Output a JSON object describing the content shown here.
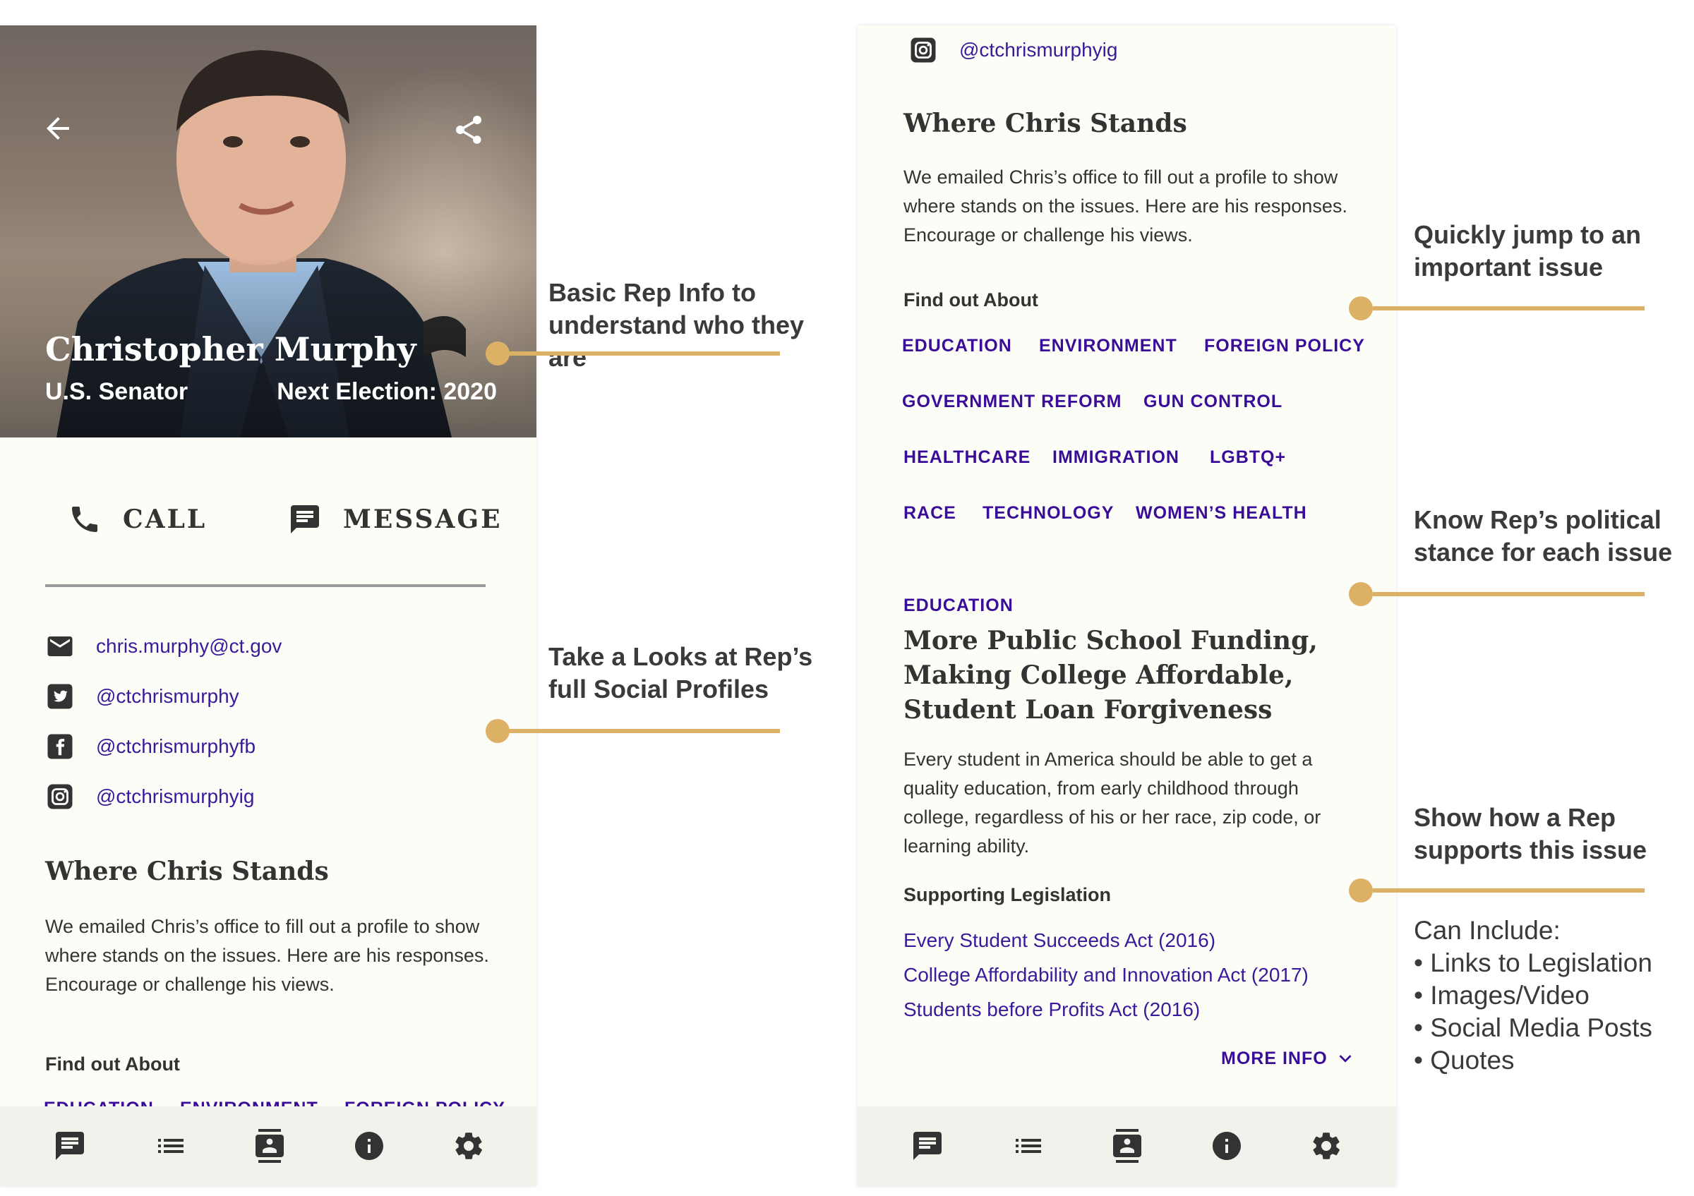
{
  "left_screen": {
    "hero": {
      "name": "Christopher Murphy",
      "role": "U.S. Senator",
      "election": "Next Election: 2020"
    },
    "actions": {
      "call": "CALL",
      "message": "MESSAGE"
    },
    "contacts": {
      "email": "chris.murphy@ct.gov",
      "twitter": "@ctchrismurphy",
      "facebook": "@ctchrismurphyfb",
      "instagram": "@ctchrismurphyig"
    },
    "stands": {
      "title": "Where Chris Stands",
      "body": "We emailed Chris’s office to fill out a profile to show where stands on the issues. Here are his responses. Encourage or challenge his views."
    },
    "find_out": {
      "label": "Find out About",
      "topics": [
        "EDUCATION",
        "ENVIRONMENT",
        "FOREIGN POLICY"
      ]
    }
  },
  "right_screen": {
    "instagram": "@ctchrismurphyig",
    "stands": {
      "title": "Where Chris Stands",
      "body": "We emailed Chris’s office to fill out a profile to show where stands on the issues. Here are his responses. Encourage or challenge his views."
    },
    "find_out": {
      "label": "Find out About",
      "topics": [
        "EDUCATION",
        "ENVIRONMENT",
        "FOREIGN POLICY",
        "GOVERNMENT REFORM",
        "GUN CONTROL",
        "HEALTHCARE",
        "IMMIGRATION",
        "LGBTQ+",
        "RACE",
        "TECHNOLOGY",
        "WOMEN’S HEALTH"
      ]
    },
    "issue": {
      "category": "EDUCATION",
      "title": "More Public School Funding, Making College Affordable, Student Loan Forgiveness",
      "body": "Every student in America should be able to get a quality education, from early childhood through college, regardless of his or her race, zip code, or learning ability.",
      "legislation_label": "Supporting Legislation",
      "legislation": [
        "Every Student Succeeds Act (2016)",
        "College Affordability and Innovation Act (2017)",
        "Students before Profits Act (2016)"
      ],
      "more_info": "MORE INFO"
    }
  },
  "nav_icons": [
    "chat-icon",
    "list-icon",
    "contact-card-icon",
    "info-icon",
    "gear-icon"
  ],
  "callouts": {
    "basic_info": "Basic Rep Info to understand who they are",
    "social": "Take a Looks at Rep’s full Social Profiles",
    "jump": "Quickly jump to an important issue",
    "stance": "Know Rep’s political stance for each issue",
    "support": "Show how a Rep supports this issue",
    "include_label": "Can Include:",
    "include_items": [
      "Links to Legislation",
      "Images/Video",
      "Social Media Posts",
      "Quotes"
    ]
  },
  "colors": {
    "accent": "#3a0d99",
    "callout": "#dcb166",
    "text": "#333333"
  }
}
